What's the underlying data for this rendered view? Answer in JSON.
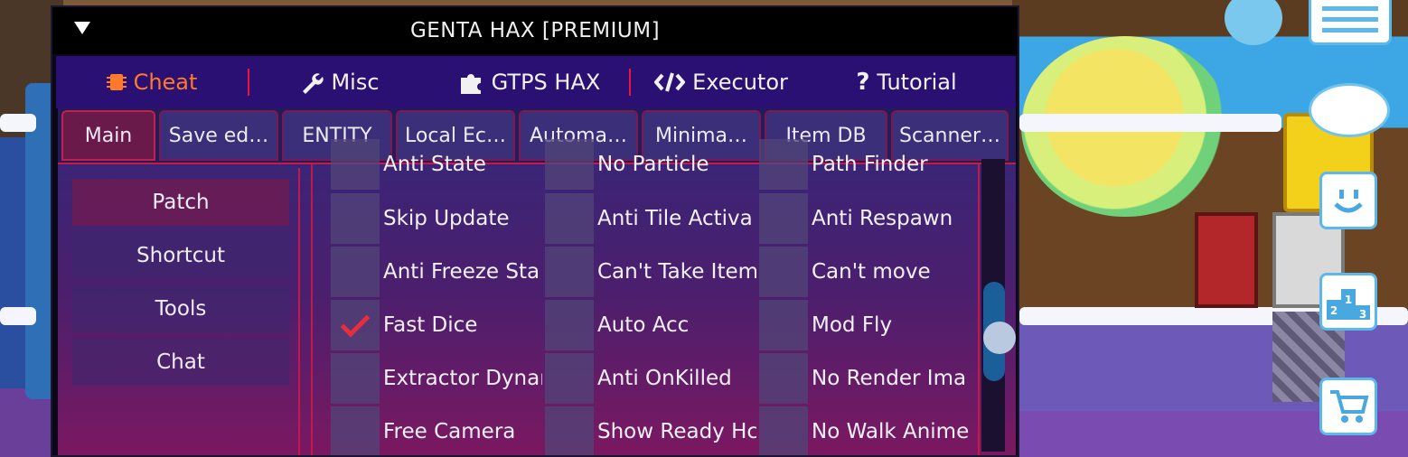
{
  "window": {
    "title": "GENTA HAX [PREMIUM]"
  },
  "top_tabs": [
    {
      "label": "Cheat",
      "icon": "chip-icon",
      "active": true
    },
    {
      "label": "Misc",
      "icon": "wrench-icon",
      "active": false
    },
    {
      "label": "GTPS HAX",
      "icon": "puzzle-icon",
      "active": false
    },
    {
      "label": "Executor",
      "icon": "code-icon",
      "active": false
    },
    {
      "label": "Tutorial",
      "icon": "question-icon",
      "active": false
    }
  ],
  "sub_tabs": [
    {
      "label": "Main",
      "active": true
    },
    {
      "label": "Save ed…",
      "active": false
    },
    {
      "label": "ENTITY",
      "active": false
    },
    {
      "label": "Local Ec…",
      "active": false
    },
    {
      "label": "Automa…",
      "active": false
    },
    {
      "label": "Minima…",
      "active": false
    },
    {
      "label": "Item DB",
      "active": false
    },
    {
      "label": "Scanner…",
      "active": false
    }
  ],
  "side_nav": [
    {
      "label": "Patch",
      "active": true
    },
    {
      "label": "Shortcut",
      "active": false
    },
    {
      "label": "Tools",
      "active": false
    },
    {
      "label": "Chat",
      "active": false
    }
  ],
  "checkbox_grid": {
    "rows": [
      [
        {
          "label": "Anti State",
          "checked": false
        },
        {
          "label": "No Particle",
          "checked": false
        },
        {
          "label": "Path Finder",
          "checked": false
        }
      ],
      [
        {
          "label": "Skip Update",
          "checked": false
        },
        {
          "label": "Anti Tile Activa",
          "checked": false
        },
        {
          "label": "Anti Respawn",
          "checked": false
        }
      ],
      [
        {
          "label": "Anti Freeze Sta",
          "checked": false
        },
        {
          "label": "Can't Take Item",
          "checked": false
        },
        {
          "label": "Can't move",
          "checked": false
        }
      ],
      [
        {
          "label": "Fast Dice",
          "checked": true
        },
        {
          "label": "Auto Acc",
          "checked": false
        },
        {
          "label": "Mod Fly",
          "checked": false
        }
      ],
      [
        {
          "label": "Extractor Dynar",
          "checked": false
        },
        {
          "label": "Anti OnKilled",
          "checked": false
        },
        {
          "label": "No Render Ima",
          "checked": false
        }
      ],
      [
        {
          "label": "Free Camera",
          "checked": false
        },
        {
          "label": "Show Ready Hc",
          "checked": false
        },
        {
          "label": "No Walk Anime",
          "checked": false
        }
      ]
    ]
  },
  "game_hud": {
    "icons": [
      "chat-bubble-icon",
      "smiley-icon",
      "leaderboard-icon",
      "cart-icon",
      "list-icon",
      "eye-off-icon"
    ],
    "podium_numbers": {
      "first": "1",
      "second": "2",
      "third": "3"
    }
  },
  "colors": {
    "accent_active_tab": "#ff7a2c",
    "separator_red": "#e5173a",
    "check_red": "#e62e3e"
  }
}
